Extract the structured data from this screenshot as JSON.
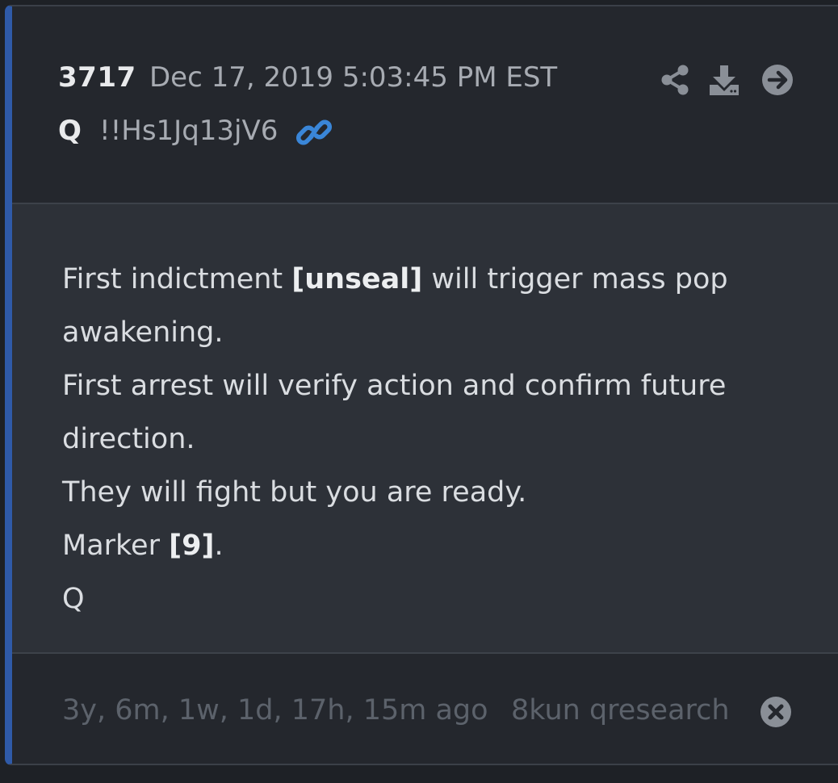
{
  "post": {
    "number": "3717",
    "date": "Dec 17, 2019 5:03:45 PM EST",
    "author": "Q",
    "tripcode": "!!Hs1Jq13jV6",
    "message": {
      "line1_pre": "First indictment ",
      "line1_bold": "[unseal]",
      "line1_post": " will trigger mass pop",
      "line2": "awakening.",
      "line3": "First arrest will verify action and confirm future",
      "line4": "direction.",
      "line5": "They will fight but you are ready.",
      "line6_pre": "Marker ",
      "line6_bold": "[9]",
      "line6_post": ".",
      "line7": "Q"
    },
    "footer": {
      "ago": "3y, 6m, 1w, 1d, 17h, 15m ago",
      "board": "8kun qresearch"
    }
  },
  "icons": {
    "link": "link-icon",
    "share": "share-icon",
    "download": "download-icon",
    "goto": "arrow-circle-right-icon",
    "close": "close-circle-icon"
  },
  "colors": {
    "accent_bar": "#2f5aa8",
    "link": "#3a86d8",
    "header_bg": "#24272d",
    "body_bg": "#2d3138"
  }
}
